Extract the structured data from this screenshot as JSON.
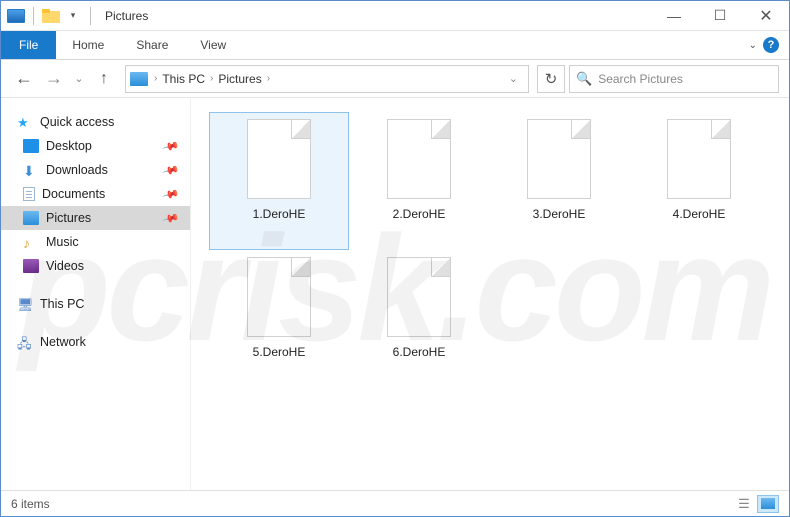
{
  "titlebar": {
    "title": "Pictures",
    "minimize": "—",
    "maximize": "☐",
    "close": "✕"
  },
  "ribbon": {
    "file": "File",
    "tabs": [
      "Home",
      "Share",
      "View"
    ],
    "help": "?"
  },
  "navbar": {
    "back": "←",
    "forward": "→",
    "recent": "⌄",
    "up": "↑",
    "refresh": "↻",
    "breadcrumbs": [
      "This PC",
      "Pictures"
    ],
    "search_placeholder": "Search Pictures"
  },
  "sidebar": {
    "quick_access": "Quick access",
    "items": [
      {
        "label": "Desktop",
        "pinned": true
      },
      {
        "label": "Downloads",
        "pinned": true
      },
      {
        "label": "Documents",
        "pinned": true
      },
      {
        "label": "Pictures",
        "pinned": true,
        "selected": true
      },
      {
        "label": "Music",
        "pinned": false
      },
      {
        "label": "Videos",
        "pinned": false
      }
    ],
    "this_pc": "This PC",
    "network": "Network"
  },
  "files": [
    {
      "name": "1.DeroHE",
      "selected": true
    },
    {
      "name": "2.DeroHE",
      "selected": false
    },
    {
      "name": "3.DeroHE",
      "selected": false
    },
    {
      "name": "4.DeroHE",
      "selected": false
    },
    {
      "name": "5.DeroHE",
      "selected": false
    },
    {
      "name": "6.DeroHE",
      "selected": false
    }
  ],
  "statusbar": {
    "count": "6 items"
  },
  "pin_glyph": "📌",
  "watermark": "pcrisk.com"
}
